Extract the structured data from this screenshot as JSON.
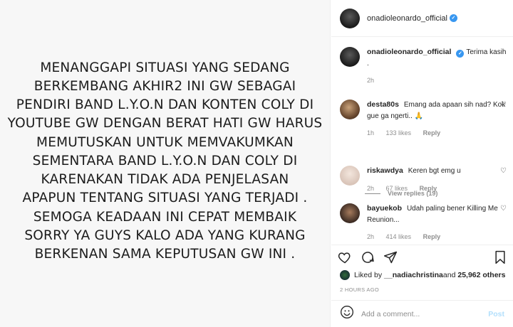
{
  "image": {
    "lines": [
      "MENANGGAPI SITUASI YANG SEDANG",
      "BERKEMBANG AKHIR2 INI GW SEBAGAI",
      "PENDIRI BAND L.Y.O.N DAN KONTEN COLY DI",
      "YOUTUBE GW DENGAN BERAT HATI GW HARUS",
      "MEMUTUSKAN UNTUK MEMVAKUMKAN",
      "SEMENTARA BAND L.Y.O.N DAN COLY DI",
      "KARENAKAN TIDAK ADA PENJELASAN",
      "APAPUN TENTANG SITUASI YANG TERJADI  .",
      "SEMOGA KEADAAN INI CEPAT MEMBAIK",
      "SORRY YA GUYS KALO ADA YANG KURANG",
      "BERKENAN SAMA KEPUTUSAN GW INI ."
    ]
  },
  "header": {
    "username": "onadioleonardo_official"
  },
  "comments": [
    {
      "username": "onadioleonardo_official",
      "text": "Terima kasih .",
      "time": "2h",
      "likes": "",
      "reply": ""
    },
    {
      "username": "desta80s",
      "text": "Emang ada apaan sih nad? Kok gue ga ngerti.. 🙏",
      "time": "1h",
      "likes": "133 likes",
      "reply": "Reply"
    },
    {
      "username": "riskawdya",
      "text": "Keren bgt emg u",
      "time": "2h",
      "likes": "67 likes",
      "reply": "Reply"
    },
    {
      "username": "bayuekob",
      "text": "Udah paling bener Killing Me Reunion...",
      "time": "2h",
      "likes": "414 likes",
      "reply": "Reply"
    }
  ],
  "view_replies": "View replies (19)",
  "likes": {
    "prefix": "Liked by ",
    "user": "__nadiachristina",
    "middle": " and ",
    "count": "25,962 others"
  },
  "timestamp": "2 HOURS AGO",
  "add_comment": {
    "placeholder": "Add a comment...",
    "post_label": "Post"
  },
  "icons": [
    "heart-icon",
    "comment-icon",
    "share-icon",
    "bookmark-icon",
    "emoji-icon",
    "verified-icon"
  ],
  "colors": {
    "verified": "#3897f0",
    "post_button": "#b2dffc",
    "muted": "#8e8e8e"
  }
}
